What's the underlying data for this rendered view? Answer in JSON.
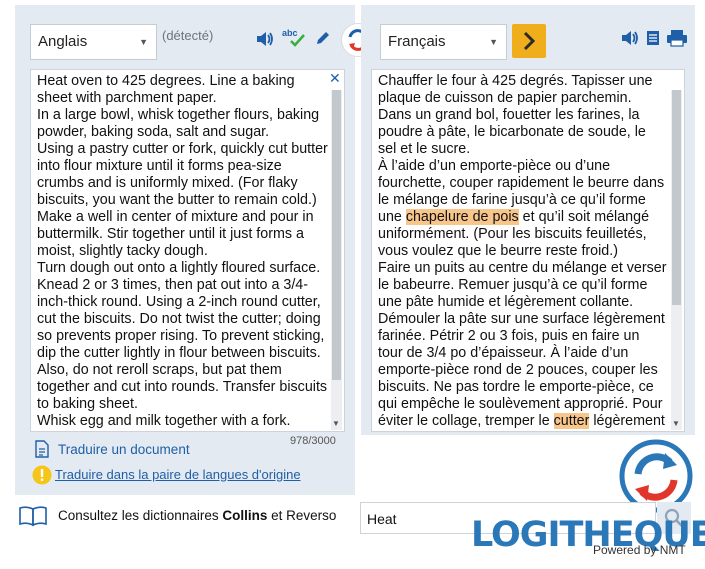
{
  "source": {
    "language": "Anglais",
    "detected": "(détecté)",
    "char_count": "978/3000",
    "text": "Heat oven to 425 degrees. Line a baking sheet with parchment paper.\nIn a large bowl, whisk together flours, baking powder, baking soda, salt and sugar.\nUsing a pastry cutter or fork, quickly cut butter into flour mixture until it forms pea-size crumbs and is uniformly mixed. (For flaky biscuits, you want the butter to remain cold.)\nMake a well in center of mixture and pour in buttermilk. Stir together until it just forms a moist, slightly tacky dough.\nTurn dough out onto a lightly floured surface. Knead 2 or 3 times, then pat out into a 3/4-inch-thick round. Using a 2-inch round cutter, cut the biscuits. Do not twist the cutter; doing so prevents proper rising. To prevent sticking, dip the cutter lightly in flour between biscuits. Also, do not reroll scraps, but pat them together and cut into rounds. Transfer biscuits to baking sheet.\nWhisk egg and milk together with a fork."
  },
  "target": {
    "language": "Français",
    "text_parts": [
      "Chauffer le four à 425 degrés. Tapisser une plaque de cuisson de papier parchemin.\nDans un grand bol, fouetter les farines, la poudre à pâte, le bicarbonate de soude, le sel et le sucre.\nÀ l’aide d’un emporte-pièce ou d’une fourchette, couper rapidement le beurre dans le mélange de farine jusqu’à ce qu’il forme une ",
      "chapelure de pois",
      " et qu’il soit mélangé uniformément. (Pour les biscuits feuilletés, vous voulez que le beurre reste froid.)\nFaire un puits au centre du mélange et verser le babeurre. Remuer jusqu’à ce qu’il forme une pâte humide et légèrement collante.\nDémouler la pâte sur une surface légèrement farinée. Pétrir 2 ou 3 fois, puis en faire un tour de 3/4 po d’épaisseur. À l’aide d’un emporte-pièce rond de 2 pouces, couper les biscuits. Ne pas tordre le emporte-pièce, ce qui empêche le soulèvement approprié. Pour éviter le collage, tremper le ",
      "cutter",
      " légèrement"
    ]
  },
  "links": {
    "translate_document": "Traduire un document",
    "translate_original_pair": "Traduire dans la paire de langues d'origine"
  },
  "dictionary": {
    "prefix": "Consultez les dictionnaires ",
    "collins": "Collins",
    "middle": " et ",
    "reverso": "Reverso",
    "search_value": "Heat"
  },
  "branding": {
    "logo_text": "LOGITHEQUE",
    "powered": "Powered by NMT"
  },
  "colors": {
    "panel": "#e4eaf1",
    "accent_blue": "#1f5fa8",
    "go_button": "#f0ad1c",
    "highlight": "#f8c58a"
  },
  "icons": [
    "chevron-down-icon",
    "speaker-icon",
    "spellcheck-icon",
    "pencil-icon",
    "swap-icon",
    "chevron-right-icon",
    "document-icon",
    "printer-icon",
    "close-icon",
    "warning-icon",
    "book-icon",
    "search-icon",
    "logo-refresh-icon"
  ]
}
